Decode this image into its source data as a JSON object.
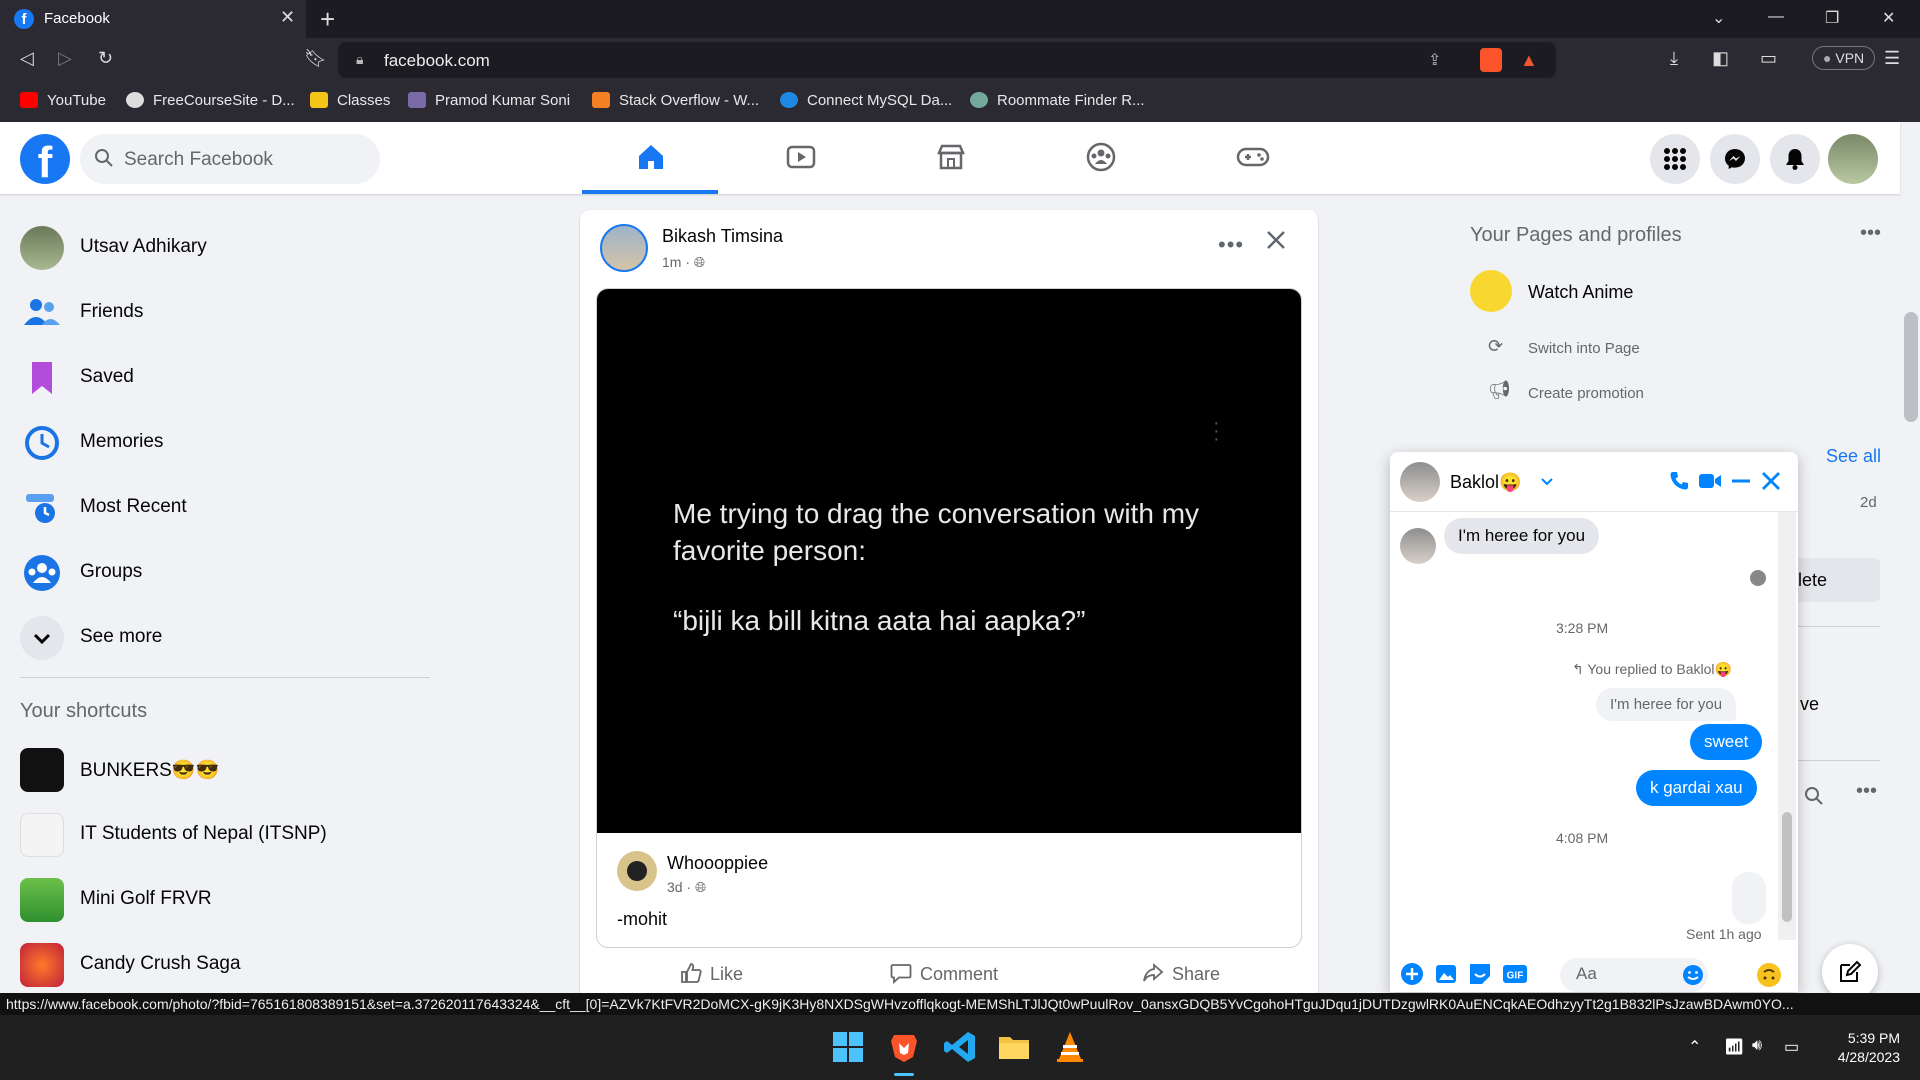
{
  "browser": {
    "tab_title": "Facebook",
    "url": "facebook.com",
    "vpn_label": "VPN",
    "bookmarks": [
      {
        "label": "YouTube",
        "color": "#ff0000"
      },
      {
        "label": "FreeCourseSite - D...",
        "color": "#eeeeee"
      },
      {
        "label": "Classes",
        "color": "#f5c518"
      },
      {
        "label": "Pramod Kumar Soni",
        "color": "#7a6aa8"
      },
      {
        "label": "Stack Overflow - W...",
        "color": "#f48024"
      },
      {
        "label": "Connect MySQL Da...",
        "color": "#1e88e5"
      },
      {
        "label": "Roommate Finder R...",
        "color": "#74aa9c"
      }
    ],
    "status_url": "https://www.facebook.com/photo/?fbid=765161808389151&set=a.372620117643324&__cft__[0]=AZVk7KtFVR2DoMCX-gK9jK3Hy8NXDSgWHvzofflqkogt-MEMShLTJlJQt0wPuulRov_0ansxGDQB5YvCgohoHTguJDqu1jDUTDzgwlRK0AuENCqkAEOdhzyyTt2g1B832lPsJzawBDAwm0YO..."
  },
  "facebook": {
    "search_placeholder": "Search Facebook",
    "brand_color": "#1877f2"
  },
  "left_nav": {
    "items": [
      {
        "label": "Utsav Adhikary"
      },
      {
        "label": "Friends"
      },
      {
        "label": "Saved"
      },
      {
        "label": "Memories"
      },
      {
        "label": "Most Recent"
      },
      {
        "label": "Groups"
      },
      {
        "label": "See more"
      }
    ],
    "shortcuts_heading": "Your shortcuts",
    "shortcuts": [
      {
        "label": "BUNKERS😎😎"
      },
      {
        "label": "IT Students of Nepal (ITSNP)"
      },
      {
        "label": "Mini Golf FRVR"
      },
      {
        "label": "Candy Crush Saga"
      }
    ]
  },
  "post": {
    "author": "Bikash Timsina",
    "time": "1m · ",
    "image_text_1": "Me trying to drag the conversation with my favorite person:",
    "image_text_2": "“bijli ka bill kitna aata hai aapka?”",
    "shared_author": "Whoooppiee",
    "shared_time": "3d · ",
    "shared_text": "-mohit",
    "actions": {
      "like": "Like",
      "comment": "Comment",
      "share": "Share"
    }
  },
  "right_panel": {
    "pages_heading": "Your Pages and profiles",
    "page_name": "Watch Anime",
    "switch_label": "Switch into Page",
    "promo_label": "Create promotion",
    "see_all": "See all",
    "age": "2d",
    "delete_partial": "lete",
    "ve_partial": "ve"
  },
  "chat": {
    "contact": "Baklol😛",
    "messages": {
      "in_1": "I'm heree for you",
      "time_1": "3:28 PM",
      "replied_to": "You replied to Baklol😛",
      "quote": "I'm heree for you",
      "out_1": "sweet",
      "out_2": "k gardai xau",
      "time_2": "4:08 PM",
      "sent_status": "Sent 1h ago"
    },
    "input_placeholder": "Aa"
  },
  "taskbar": {
    "time": "5:39 PM",
    "date": "4/28/2023"
  }
}
